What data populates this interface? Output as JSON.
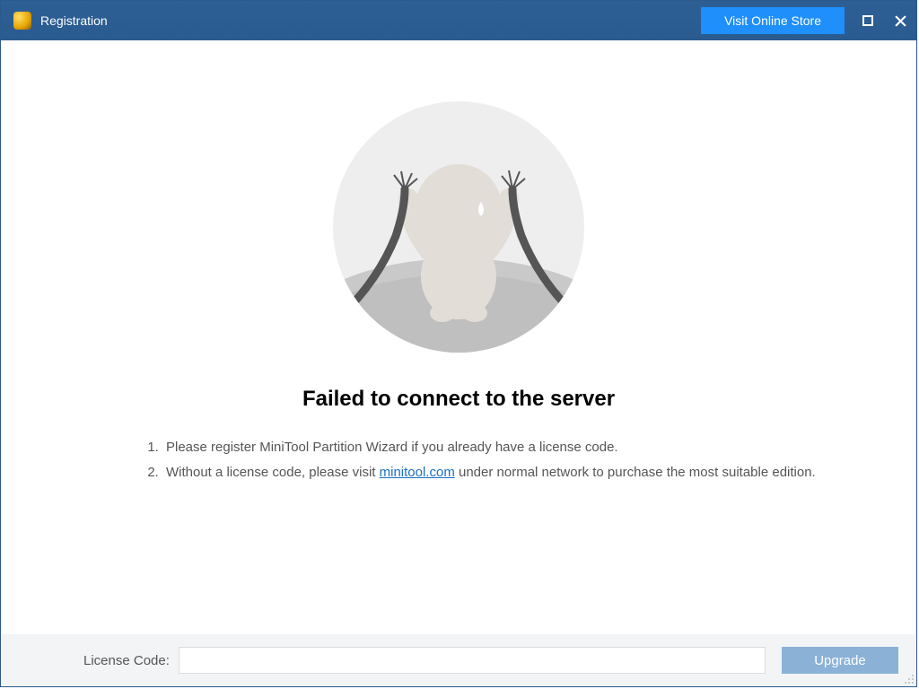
{
  "titlebar": {
    "title": "Registration",
    "visit_store": "Visit Online Store"
  },
  "content": {
    "error_title": "Failed to connect to the server",
    "hint1": "Please register MiniTool Partition Wizard if you already have a license code.",
    "hint2_prefix": "Without a license code, please visit ",
    "hint2_link": "minitool.com",
    "hint2_suffix": " under normal network to purchase the most suitable edition."
  },
  "footer": {
    "license_label": "License Code:",
    "license_value": "",
    "upgrade": "Upgrade"
  }
}
